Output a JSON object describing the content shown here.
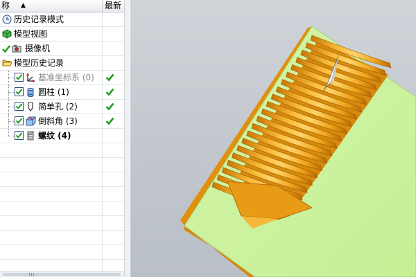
{
  "navigator": {
    "columns": {
      "name": "称",
      "latest": "最新"
    },
    "rows": [
      {
        "label": "历史记录模式",
        "icon": "clock-icon",
        "latest_check": false,
        "suppressed": false,
        "bold": false
      },
      {
        "label": "模型视图",
        "icon": "model-view-icon",
        "latest_check": false,
        "suppressed": false,
        "bold": false
      },
      {
        "label": "摄像机",
        "icon": "camera-icon",
        "latest_check": false,
        "suppressed": false,
        "bold": false
      },
      {
        "label": "模型历史记录",
        "icon": "folder-open-icon",
        "latest_check": false,
        "suppressed": false,
        "bold": false
      },
      {
        "label": "基准坐标系 (0)",
        "icon": "datum-csys-icon",
        "latest_check": true,
        "suppressed": true,
        "bold": false
      },
      {
        "label": "圆柱 (1)",
        "icon": "cylinder-icon",
        "latest_check": true,
        "suppressed": false,
        "bold": false
      },
      {
        "label": "简单孔 (2)",
        "icon": "hole-icon",
        "latest_check": true,
        "suppressed": false,
        "bold": false
      },
      {
        "label": "倒斜角 (3)",
        "icon": "chamfer-icon",
        "latest_check": true,
        "suppressed": false,
        "bold": false
      },
      {
        "label": "螺纹 (4)",
        "icon": "thread-icon",
        "latest_check": false,
        "suppressed": false,
        "bold": true
      }
    ],
    "empty_rows": 9
  },
  "colors": {
    "check_green": "#1e9e1e",
    "part_face": "#cdf3a0",
    "part_edge": "#e59a12",
    "thread_gold": "#f2a81e",
    "viewport_bg": "#c6cbd1"
  }
}
